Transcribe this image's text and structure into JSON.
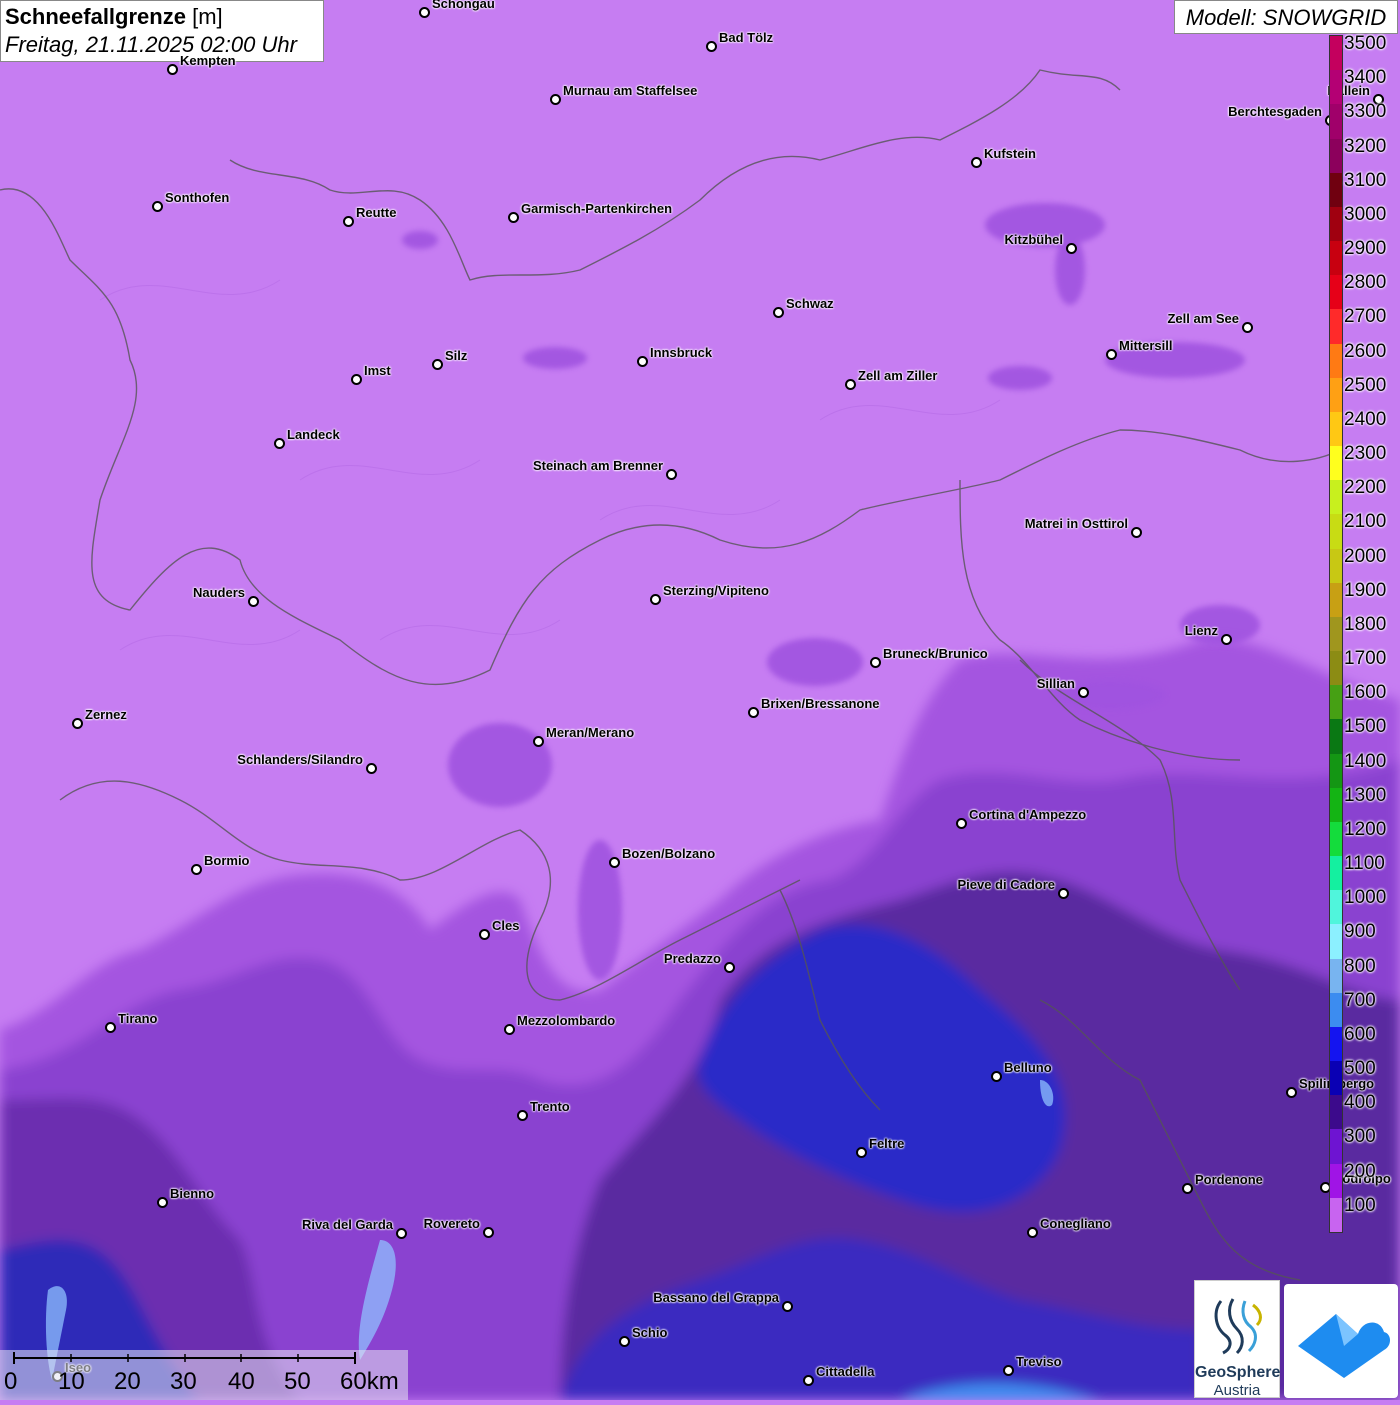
{
  "header": {
    "title_bold": "Schneefallgrenze",
    "title_unit": "[m]",
    "datetime": "Freitag, 21.11.2025 02:00 Uhr",
    "model": "Modell: SNOWGRID"
  },
  "legend": {
    "values": [
      "3500",
      "3400",
      "3300",
      "3200",
      "3100",
      "3000",
      "2900",
      "2800",
      "2700",
      "2600",
      "2500",
      "2400",
      "2300",
      "2200",
      "2100",
      "2000",
      "1900",
      "1800",
      "1700",
      "1600",
      "1500",
      "1400",
      "1300",
      "1200",
      "1100",
      "1000",
      "900",
      "800",
      "700",
      "600",
      "500",
      "400",
      "300",
      "200",
      "100"
    ],
    "colors": [
      "#c4005e",
      "#b40074",
      "#a0006a",
      "#8c005c",
      "#700010",
      "#a00010",
      "#c80010",
      "#e60018",
      "#ff2a2a",
      "#ff7a14",
      "#ffa014",
      "#ffc814",
      "#ffff1e",
      "#c8f01e",
      "#c8dc14",
      "#c8c814",
      "#c8a014",
      "#a0961e",
      "#8c8c14",
      "#46a014",
      "#0a7814",
      "#149614",
      "#14b414",
      "#14dc3c",
      "#14f0a0",
      "#50f5dc",
      "#8cf0ff",
      "#78b4f0",
      "#3c8cf0",
      "#1414f0",
      "#0a00b4",
      "#3c0a8c",
      "#6e14d2",
      "#a014e6",
      "#c864f0"
    ]
  },
  "cities": [
    {
      "name": "Schongau"
    },
    {
      "name": "Bad Tölz"
    },
    {
      "name": "Kempten"
    },
    {
      "name": "Murnau am Staffelsee"
    },
    {
      "name": "Hallein"
    },
    {
      "name": "Berchtesgaden"
    },
    {
      "name": "Kufstein"
    },
    {
      "name": "Sonthofen"
    },
    {
      "name": "Reutte"
    },
    {
      "name": "Garmisch-Partenkirchen"
    },
    {
      "name": "Kitzbühel"
    },
    {
      "name": "Schwaz"
    },
    {
      "name": "Zell am See"
    },
    {
      "name": "Mittersill"
    },
    {
      "name": "Innsbruck"
    },
    {
      "name": "Imst"
    },
    {
      "name": "Silz"
    },
    {
      "name": "Zell am Ziller"
    },
    {
      "name": "Landeck"
    },
    {
      "name": "Steinach am Brenner"
    },
    {
      "name": "Matrei in Osttirol"
    },
    {
      "name": "Nauders"
    },
    {
      "name": "Sterzing/Vipiteno"
    },
    {
      "name": "Lienz"
    },
    {
      "name": "Bruneck/Brunico"
    },
    {
      "name": "Sillian"
    },
    {
      "name": "Zernez"
    },
    {
      "name": "Brixen/Bressanone"
    },
    {
      "name": "Meran/Merano"
    },
    {
      "name": "Schlanders/Silandro"
    },
    {
      "name": "Cortina d'Ampezzo"
    },
    {
      "name": "Bormio"
    },
    {
      "name": "Bozen/Bolzano"
    },
    {
      "name": "Pieve di Cadore"
    },
    {
      "name": "Cles"
    },
    {
      "name": "Predazzo"
    },
    {
      "name": "Tirano"
    },
    {
      "name": "Mezzolombardo"
    },
    {
      "name": "Belluno"
    },
    {
      "name": "Spilimbergo"
    },
    {
      "name": "Trento"
    },
    {
      "name": "Feltre"
    },
    {
      "name": "Pordenone"
    },
    {
      "name": "Codroipo"
    },
    {
      "name": "Bienno"
    },
    {
      "name": "Riva del Garda"
    },
    {
      "name": "Rovereto"
    },
    {
      "name": "Conegliano"
    },
    {
      "name": "Bassano del Grappa"
    },
    {
      "name": "Schio"
    },
    {
      "name": "Treviso"
    },
    {
      "name": "Cittadella"
    },
    {
      "name": "Iseo"
    }
  ],
  "scale": {
    "labels": [
      "0",
      "10",
      "20",
      "30",
      "40",
      "50",
      "60km"
    ]
  },
  "logos": {
    "geosphere_line1": "GeoSphere",
    "geosphere_line2": "Austria",
    "geosphere_icon": "geosphere-logo-icon",
    "app_icon": "weather-app-cloud-icon"
  }
}
